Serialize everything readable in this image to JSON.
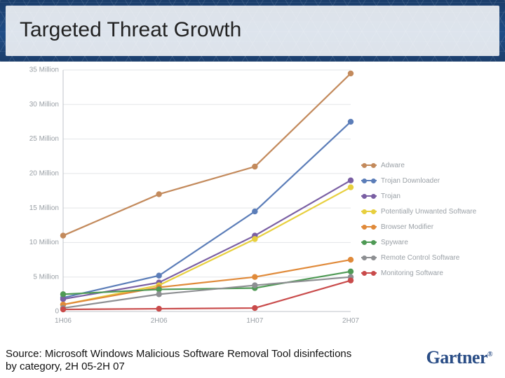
{
  "title": "Targeted Threat Growth",
  "source_line": "Source: Microsoft Windows Malicious Software Removal Tool disinfections by category, 2H 05-2H 07",
  "brand": "Gartner",
  "chart_data": {
    "type": "line",
    "xlabel": "",
    "ylabel": "",
    "title": "",
    "categories": [
      "1H06",
      "2H06",
      "1H07",
      "2H07"
    ],
    "y_ticks": [
      0,
      5000000,
      10000000,
      15000000,
      20000000,
      25000000,
      30000000,
      35000000
    ],
    "y_tick_labels": [
      "0",
      "5 Million",
      "10 Million",
      "15 Million",
      "20 Million",
      "25 Million",
      "30 Million",
      "35 Million"
    ],
    "ylim": [
      0,
      35000000
    ],
    "series": [
      {
        "name": "Adware",
        "color": "#c38a5c",
        "values": [
          11000000,
          17000000,
          21000000,
          34500000
        ]
      },
      {
        "name": "Trojan Downloader",
        "color": "#5b7db8",
        "values": [
          2000000,
          5200000,
          14500000,
          27500000
        ]
      },
      {
        "name": "Trojan",
        "color": "#7a5fa3",
        "values": [
          1800000,
          4200000,
          11000000,
          19000000
        ]
      },
      {
        "name": "Potentially Unwanted Software",
        "color": "#e7cf3e",
        "values": [
          1000000,
          3800000,
          10500000,
          18000000
        ]
      },
      {
        "name": "Browser Modifier",
        "color": "#e08a3a",
        "values": [
          1000000,
          3500000,
          5000000,
          7500000
        ]
      },
      {
        "name": "Spyware",
        "color": "#4f9a55",
        "values": [
          2500000,
          3200000,
          3400000,
          5800000
        ]
      },
      {
        "name": "Remote Control Software",
        "color": "#8d8f92",
        "values": [
          500000,
          2500000,
          3800000,
          5000000
        ]
      },
      {
        "name": "Monitoring Software",
        "color": "#c94b4b",
        "values": [
          300000,
          400000,
          500000,
          4500000
        ]
      }
    ]
  }
}
